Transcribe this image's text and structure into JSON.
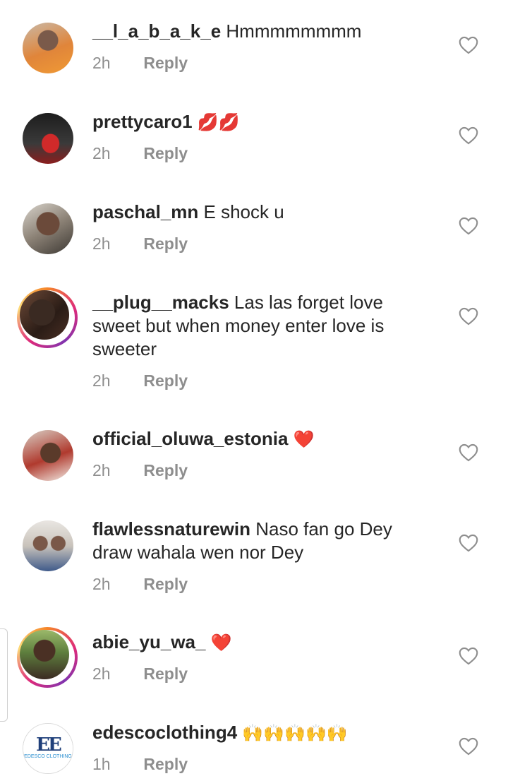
{
  "comments": [
    {
      "username": "__l_a_b_a_k_e",
      "text": "Hmmmmmmmm",
      "time": "2h",
      "reply": "Reply",
      "avatar_icon": "avatar-photo"
    },
    {
      "username": "prettycaro1",
      "text": "💋💋",
      "time": "2h",
      "reply": "Reply",
      "avatar_icon": "avatar-photo"
    },
    {
      "username": "paschal_mn",
      "text": "E shock u",
      "time": "2h",
      "reply": "Reply",
      "avatar_icon": "avatar-photo"
    },
    {
      "username": "__plug__macks",
      "text": "Las las forget love sweet but when money enter love is sweeter",
      "time": "2h",
      "reply": "Reply",
      "avatar_icon": "avatar-photo-story"
    },
    {
      "username": "official_oluwa_estonia",
      "text": "❤️",
      "time": "2h",
      "reply": "Reply",
      "avatar_icon": "avatar-photo"
    },
    {
      "username": "flawlessnaturewin",
      "text": "Naso fan go Dey draw wahala wen nor Dey",
      "time": "2h",
      "reply": "Reply",
      "avatar_icon": "avatar-photo"
    },
    {
      "username": "abie_yu_wa_",
      "text": "❤️",
      "time": "2h",
      "reply": "Reply",
      "avatar_icon": "avatar-photo-story"
    },
    {
      "username": "edescoclothing4",
      "text": "🙌🙌🙌🙌🙌",
      "time": "1h",
      "reply": "Reply",
      "avatar_icon": "brand-logo"
    }
  ],
  "logo": {
    "monogram": "EE",
    "brand": "EDESCO CLOTHING"
  },
  "colors": {
    "text": "#262626",
    "meta": "#8e8e8e",
    "heart_red": "#e0245e"
  }
}
